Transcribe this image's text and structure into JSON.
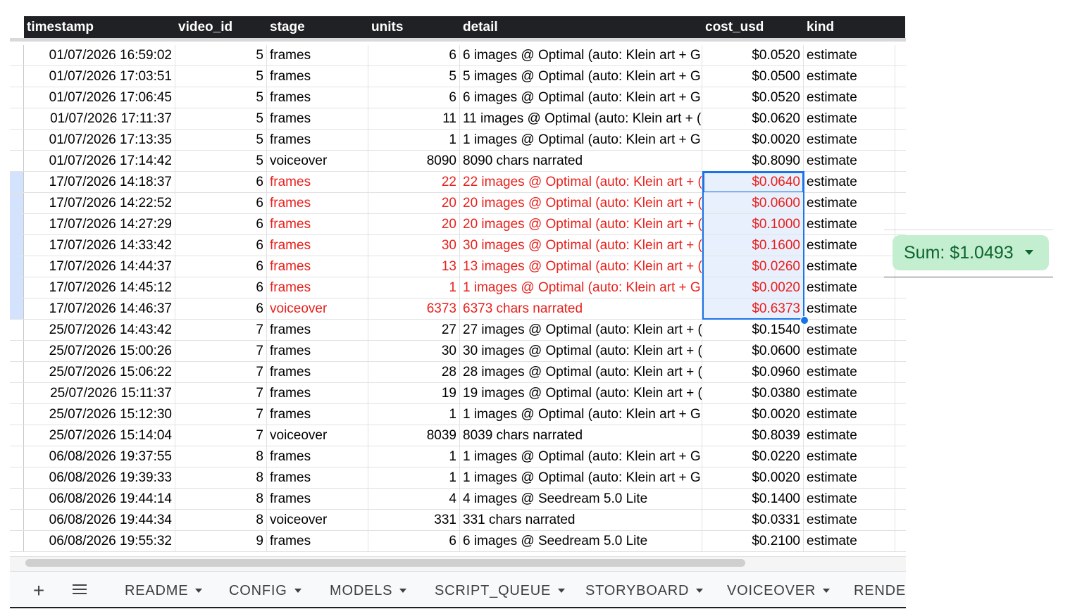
{
  "columns": [
    {
      "key": "timestamp",
      "label": "timestamp"
    },
    {
      "key": "video_id",
      "label": "video_id"
    },
    {
      "key": "stage",
      "label": "stage"
    },
    {
      "key": "units",
      "label": "units"
    },
    {
      "key": "detail",
      "label": "detail"
    },
    {
      "key": "cost_usd",
      "label": "cost_usd"
    },
    {
      "key": "kind",
      "label": "kind"
    }
  ],
  "rows": [
    {
      "timestamp": "01/07/2026 16:59:02",
      "video_id": "5",
      "stage": "frames",
      "units": "6",
      "detail": "6 images @ Optimal (auto: Klein art + G",
      "cost_usd": "$0.0520",
      "kind": "estimate",
      "selected": false
    },
    {
      "timestamp": "01/07/2026 17:03:51",
      "video_id": "5",
      "stage": "frames",
      "units": "5",
      "detail": "5 images @ Optimal (auto: Klein art + G",
      "cost_usd": "$0.0500",
      "kind": "estimate",
      "selected": false
    },
    {
      "timestamp": "01/07/2026 17:06:45",
      "video_id": "5",
      "stage": "frames",
      "units": "6",
      "detail": "6 images @ Optimal (auto: Klein art + G",
      "cost_usd": "$0.0520",
      "kind": "estimate",
      "selected": false
    },
    {
      "timestamp": "01/07/2026 17:11:37",
      "video_id": "5",
      "stage": "frames",
      "units": "11",
      "detail": "11 images @ Optimal (auto: Klein art + (",
      "cost_usd": "$0.0620",
      "kind": "estimate",
      "selected": false
    },
    {
      "timestamp": "01/07/2026 17:13:35",
      "video_id": "5",
      "stage": "frames",
      "units": "1",
      "detail": "1 images @ Optimal (auto: Klein art + G",
      "cost_usd": "$0.0020",
      "kind": "estimate",
      "selected": false
    },
    {
      "timestamp": "01/07/2026 17:14:42",
      "video_id": "5",
      "stage": "voiceover",
      "units": "8090",
      "detail": "8090 chars narrated",
      "cost_usd": "$0.8090",
      "kind": "estimate",
      "selected": false
    },
    {
      "timestamp": "17/07/2026 14:18:37",
      "video_id": "6",
      "stage": "frames",
      "units": "22",
      "detail": "22 images @ Optimal (auto: Klein art + (",
      "cost_usd": "$0.0640",
      "kind": "estimate",
      "selected": true
    },
    {
      "timestamp": "17/07/2026 14:22:52",
      "video_id": "6",
      "stage": "frames",
      "units": "20",
      "detail": "20 images @ Optimal (auto: Klein art + (",
      "cost_usd": "$0.0600",
      "kind": "estimate",
      "selected": true
    },
    {
      "timestamp": "17/07/2026 14:27:29",
      "video_id": "6",
      "stage": "frames",
      "units": "20",
      "detail": "20 images @ Optimal (auto: Klein art + (",
      "cost_usd": "$0.1000",
      "kind": "estimate",
      "selected": true
    },
    {
      "timestamp": "17/07/2026 14:33:42",
      "video_id": "6",
      "stage": "frames",
      "units": "30",
      "detail": "30 images @ Optimal (auto: Klein art + (",
      "cost_usd": "$0.1600",
      "kind": "estimate",
      "selected": true
    },
    {
      "timestamp": "17/07/2026 14:44:37",
      "video_id": "6",
      "stage": "frames",
      "units": "13",
      "detail": "13 images @ Optimal (auto: Klein art + (",
      "cost_usd": "$0.0260",
      "kind": "estimate",
      "selected": true
    },
    {
      "timestamp": "17/07/2026 14:45:12",
      "video_id": "6",
      "stage": "frames",
      "units": "1",
      "detail": "1 images @ Optimal (auto: Klein art + G",
      "cost_usd": "$0.0020",
      "kind": "estimate",
      "selected": true
    },
    {
      "timestamp": "17/07/2026 14:46:37",
      "video_id": "6",
      "stage": "voiceover",
      "units": "6373",
      "detail": "6373 chars narrated",
      "cost_usd": "$0.6373",
      "kind": "estimate",
      "selected": true
    },
    {
      "timestamp": "25/07/2026 14:43:42",
      "video_id": "7",
      "stage": "frames",
      "units": "27",
      "detail": "27 images @ Optimal (auto: Klein art + (",
      "cost_usd": "$0.1540",
      "kind": "estimate",
      "selected": false
    },
    {
      "timestamp": "25/07/2026 15:00:26",
      "video_id": "7",
      "stage": "frames",
      "units": "30",
      "detail": "30 images @ Optimal (auto: Klein art + (",
      "cost_usd": "$0.0600",
      "kind": "estimate",
      "selected": false
    },
    {
      "timestamp": "25/07/2026 15:06:22",
      "video_id": "7",
      "stage": "frames",
      "units": "28",
      "detail": "28 images @ Optimal (auto: Klein art + (",
      "cost_usd": "$0.0960",
      "kind": "estimate",
      "selected": false
    },
    {
      "timestamp": "25/07/2026 15:11:37",
      "video_id": "7",
      "stage": "frames",
      "units": "19",
      "detail": "19 images @ Optimal (auto: Klein art + (",
      "cost_usd": "$0.0380",
      "kind": "estimate",
      "selected": false
    },
    {
      "timestamp": "25/07/2026 15:12:30",
      "video_id": "7",
      "stage": "frames",
      "units": "1",
      "detail": "1 images @ Optimal (auto: Klein art + G",
      "cost_usd": "$0.0020",
      "kind": "estimate",
      "selected": false
    },
    {
      "timestamp": "25/07/2026 15:14:04",
      "video_id": "7",
      "stage": "voiceover",
      "units": "8039",
      "detail": "8039 chars narrated",
      "cost_usd": "$0.8039",
      "kind": "estimate",
      "selected": false
    },
    {
      "timestamp": "06/08/2026 19:37:55",
      "video_id": "8",
      "stage": "frames",
      "units": "1",
      "detail": "1 images @ Optimal (auto: Klein art + G",
      "cost_usd": "$0.0220",
      "kind": "estimate",
      "selected": false
    },
    {
      "timestamp": "06/08/2026 19:39:33",
      "video_id": "8",
      "stage": "frames",
      "units": "1",
      "detail": "1 images @ Optimal (auto: Klein art + G",
      "cost_usd": "$0.0020",
      "kind": "estimate",
      "selected": false
    },
    {
      "timestamp": "06/08/2026 19:44:14",
      "video_id": "8",
      "stage": "frames",
      "units": "4",
      "detail": "4 images @ Seedream 5.0 Lite",
      "cost_usd": "$0.1400",
      "kind": "estimate",
      "selected": false
    },
    {
      "timestamp": "06/08/2026 19:44:34",
      "video_id": "8",
      "stage": "voiceover",
      "units": "331",
      "detail": "331 chars narrated",
      "cost_usd": "$0.0331",
      "kind": "estimate",
      "selected": false
    },
    {
      "timestamp": "06/08/2026 19:55:32",
      "video_id": "9",
      "stage": "frames",
      "units": "6",
      "detail": "6 images @ Seedream 5.0 Lite",
      "cost_usd": "$0.2100",
      "kind": "estimate",
      "selected": false
    }
  ],
  "summary": {
    "label": "Sum: $1.0493"
  },
  "tabbar": {
    "add_label": "+",
    "tabs": [
      "README",
      "CONFIG",
      "MODELS",
      "SCRIPT_QUEUE",
      "STORYBOARD",
      "VOICEOVER",
      "RENDEI"
    ]
  },
  "colors": {
    "header_bg": "#202124",
    "selected_text": "#e8211c",
    "selection_border": "#1a73e8",
    "summary_chip_bg": "#c4eed0",
    "summary_chip_text": "#0d652d"
  },
  "icons": [
    "add-sheet-icon",
    "all-sheets-menu-icon",
    "dropdown-caret-icon"
  ]
}
